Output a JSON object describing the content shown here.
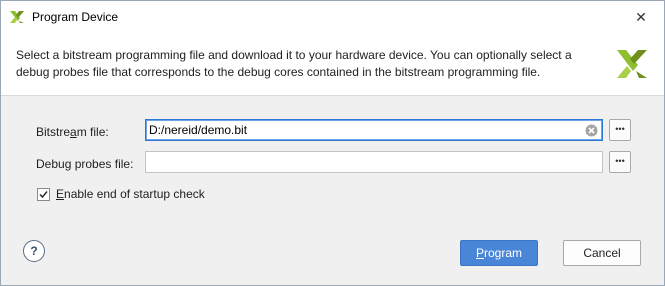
{
  "window": {
    "title": "Program Device",
    "close_glyph": "✕"
  },
  "header": {
    "description": "Select a bitstream programming file and download it to your hardware device. You can optionally select a debug probes file that corresponds to the debug cores contained in the bitstream programming file."
  },
  "form": {
    "bitstream": {
      "label_pre": "Bitstre",
      "label_mnemonic": "a",
      "label_post": "m file:",
      "value": "D:/nereid/demo.bit",
      "browse_label": "•••"
    },
    "debug_probes": {
      "label_pre": "Debu",
      "label_mnemonic": "g",
      "label_post": " probes file:",
      "value": "",
      "browse_label": "•••"
    },
    "startup_check": {
      "checked": true,
      "label_mnemonic": "E",
      "label_post": "nable end of startup check"
    }
  },
  "footer": {
    "help_label": "?",
    "program_mnemonic": "P",
    "program_post": "rogram",
    "cancel_label": "Cancel"
  },
  "colors": {
    "accent": "#4a86d8",
    "focus_border": "#2a78d6",
    "logo_green": "#8ebf2e",
    "logo_olive": "#6f8f1e"
  }
}
